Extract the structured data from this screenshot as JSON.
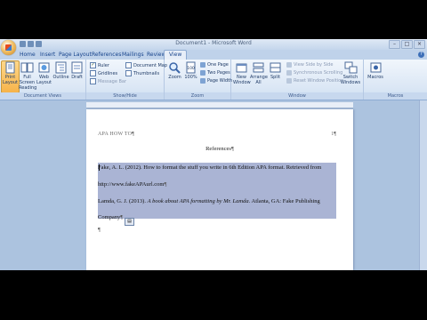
{
  "window": {
    "title": "Document1 - Microsoft Word"
  },
  "tabs": [
    "Home",
    "Insert",
    "Page Layout",
    "References",
    "Mailings",
    "Review",
    "View"
  ],
  "active_tab": "View",
  "ribbon": {
    "document_views": {
      "label": "Document Views",
      "buttons": [
        "Print Layout",
        "Full Screen Reading",
        "Web Layout",
        "Outline",
        "Draft"
      ]
    },
    "show_hide": {
      "label": "Show/Hide",
      "items": [
        "Ruler",
        "Gridlines",
        "Message Bar",
        "Document Map",
        "Thumbnails"
      ],
      "checked": [
        true,
        false,
        false,
        false,
        false
      ]
    },
    "zoom": {
      "label": "Zoom",
      "buttons": [
        "Zoom",
        "100%"
      ],
      "small": [
        "One Page",
        "Two Pages",
        "Page Width"
      ]
    },
    "window": {
      "label": "Window",
      "buttons": [
        "New Window",
        "Arrange All",
        "Split"
      ],
      "small": [
        "View Side by Side",
        "Synchronous Scrolling",
        "Reset Window Position"
      ],
      "switch": "Switch Windows"
    },
    "macros": {
      "label": "Macros",
      "button": "Macros"
    }
  },
  "document": {
    "running_head": "APA HOW TO",
    "page_number": "1",
    "heading": "References",
    "ref1_line1": "Fake, A. L. (2012). How to format the stuff you write in 6th Edition APA format. Retrieved from",
    "ref1_line2": "http://www.fakeAPAurl.com",
    "ref2_line1_a": "Lamda, G. J. (2013). ",
    "ref2_line1_b": "A book about APA formatting by Mr. Lamda.",
    "ref2_line1_c": " Atlanta, GA: Fake Publishing",
    "ref2_line2": "Company"
  },
  "colors": {
    "ribbon_bg": "#dbe7f5",
    "selection": "#aab4d4",
    "workspace": "#acc3df"
  }
}
